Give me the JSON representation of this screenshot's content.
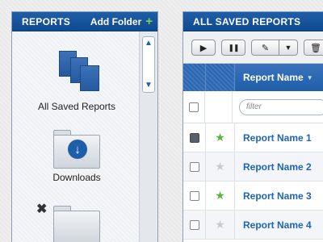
{
  "left_panel": {
    "title": "REPORTS",
    "add_folder_label": "Add Folder",
    "add_icon": "+",
    "items": [
      {
        "label": "All Saved Reports",
        "icon": "reports-stack-icon"
      },
      {
        "label": "Downloads",
        "icon": "download-folder-icon"
      },
      {
        "label": "",
        "icon": "folder-icon"
      }
    ],
    "delete_glyph": "✖",
    "scroll_up": "▲",
    "scroll_down": "▼"
  },
  "right_panel": {
    "title": "ALL SAVED REPORTS",
    "toolbar": {
      "play": "▶",
      "pause": "❚❚",
      "edit": "✎",
      "edit_dropdown": "▼",
      "trash": "🗑"
    },
    "table": {
      "column_name": "Report Name",
      "sort_glyph": "▼",
      "filter_placeholder": "filter",
      "rows": [
        {
          "name": "Report Name 1",
          "checked": true,
          "starred": true,
          "star": "★"
        },
        {
          "name": "Report Name 2",
          "checked": false,
          "starred": false,
          "star": "★"
        },
        {
          "name": "Report Name 3",
          "checked": false,
          "starred": true,
          "star": "★"
        },
        {
          "name": "Report Name 4",
          "checked": false,
          "starred": false,
          "star": "★"
        }
      ]
    }
  },
  "colors": {
    "accent": "#1f5ea8",
    "star_on": "#5bb53a",
    "star_off": "#c8ccd1",
    "link": "#1d63b8"
  }
}
